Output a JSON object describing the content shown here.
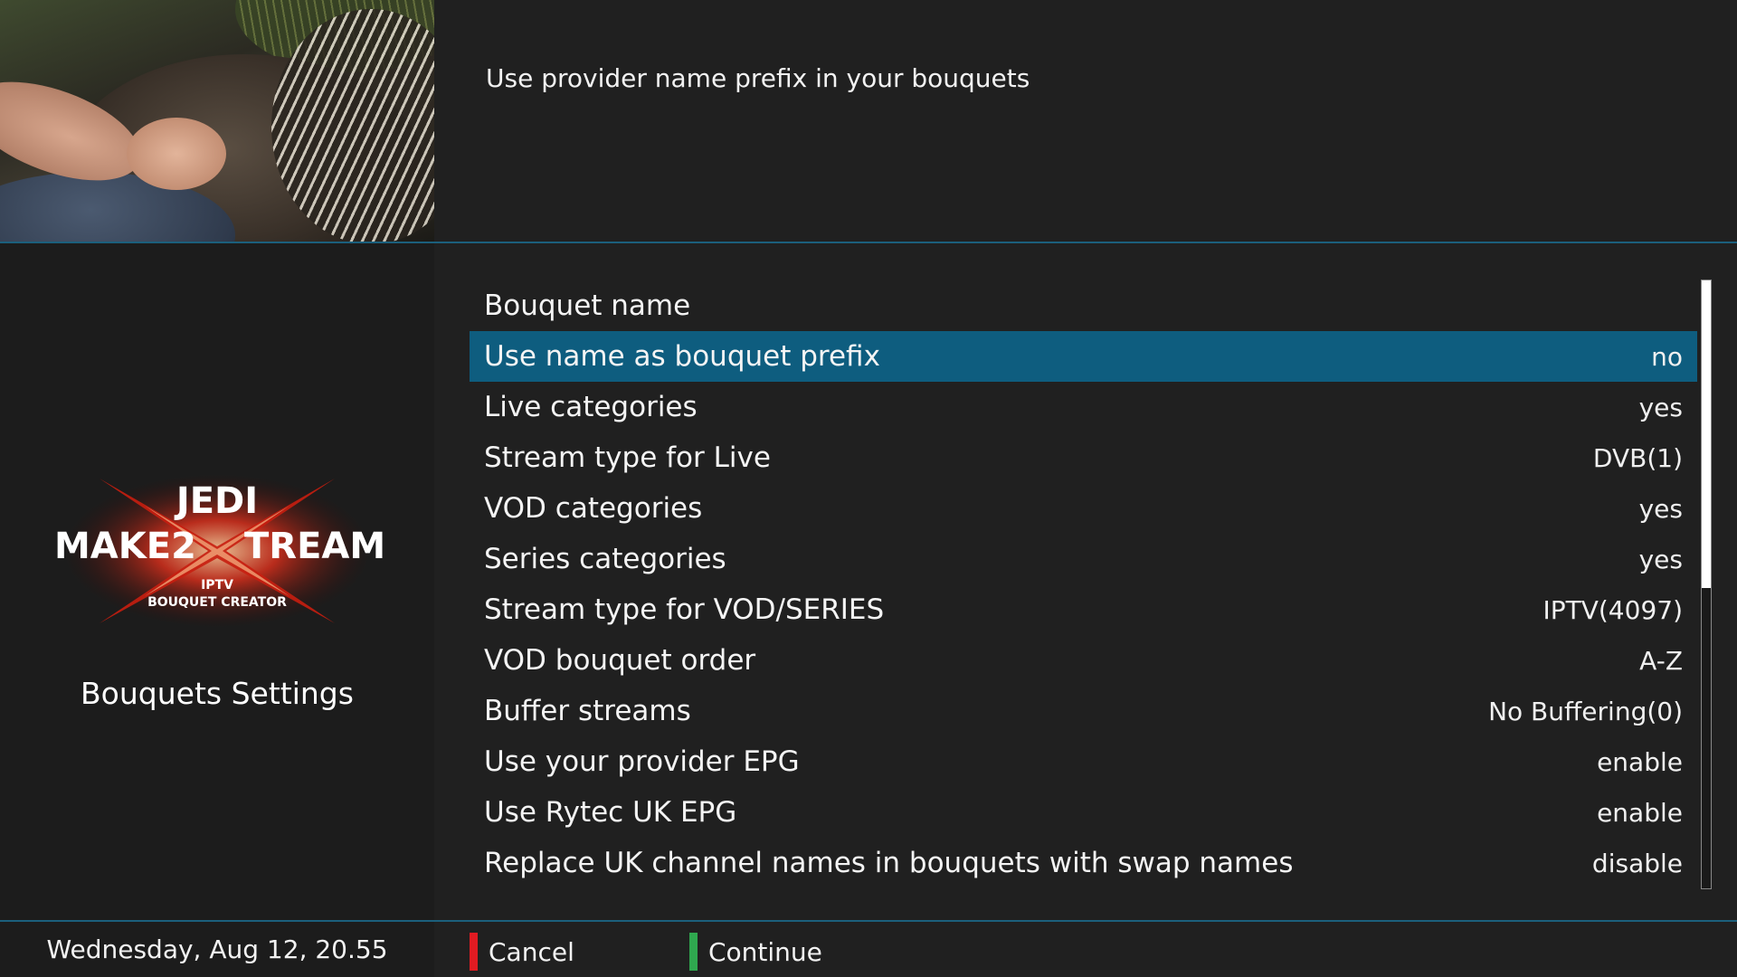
{
  "help": {
    "text": "Use provider name prefix in your bouquets"
  },
  "left_panel": {
    "logo": {
      "line1": "JEDI",
      "line2_left": "MAKE2",
      "line2_right": "TREAM",
      "line3": "IPTV",
      "line4": "BOUQUET CREATOR"
    },
    "title": "Bouquets Settings"
  },
  "settings": [
    {
      "label": "Bouquet name",
      "value": ""
    },
    {
      "label": "Use name as bouquet prefix",
      "value": "no"
    },
    {
      "label": "Live categories",
      "value": "yes"
    },
    {
      "label": "Stream type for Live",
      "value": "DVB(1)"
    },
    {
      "label": "VOD categories",
      "value": "yes"
    },
    {
      "label": "Series categories",
      "value": "yes"
    },
    {
      "label": "Stream type for VOD/SERIES",
      "value": "IPTV(4097)"
    },
    {
      "label": "VOD bouquet order",
      "value": "A-Z"
    },
    {
      "label": "Buffer streams",
      "value": "No Buffering(0)"
    },
    {
      "label": "Use your provider EPG",
      "value": "enable"
    },
    {
      "label": "Use Rytec UK EPG",
      "value": "enable"
    },
    {
      "label": "Replace UK channel names in bouquets with swap names",
      "value": "disable"
    }
  ],
  "selected_index": 1,
  "scroll_position": 0.5,
  "footer": {
    "datetime": "Wednesday, Aug 12, 20.55",
    "cancel_label": "Cancel",
    "continue_label": "Continue"
  },
  "colors": {
    "selection": "#0e5d7f",
    "red_key": "#e11b22",
    "green_key": "#2fa84f",
    "separator": "#1b5f7c"
  }
}
